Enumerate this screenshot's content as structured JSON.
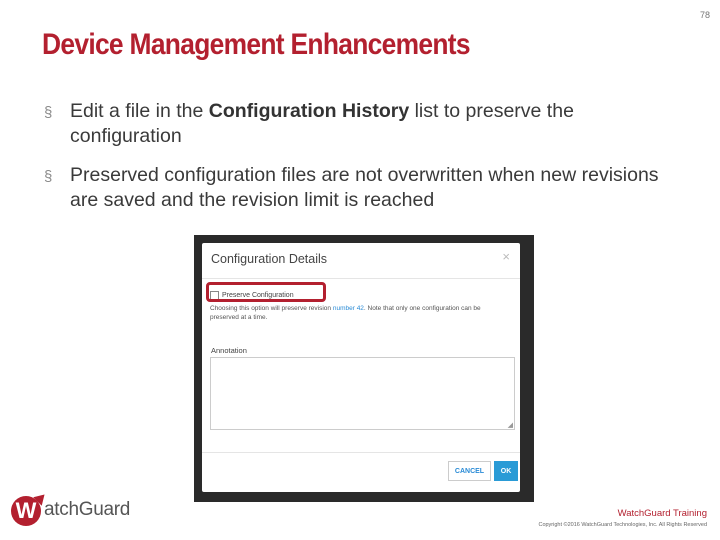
{
  "page_number": "78",
  "title": "Device Management Enhancements",
  "bullets": [
    {
      "before": "Edit a file in the ",
      "bold": "Configuration History",
      "after": " list to preserve the configuration"
    },
    {
      "before": "Preserved configuration files are not overwritten when new revisions are saved and the revision limit is reached",
      "bold": "",
      "after": ""
    }
  ],
  "bullet_mark": "§",
  "dialog": {
    "title": "Configuration Details",
    "close": "×",
    "preserve_label": "Preserve Configuration",
    "note_before": "Choosing this option will preserve revision ",
    "note_revision": "number 42",
    "note_after": ". Note that only one configuration can be preserved at a time.",
    "annotation_label": "Annotation",
    "annotation_value": "",
    "cancel_label": "CANCEL",
    "ok_label": "OK"
  },
  "colors": {
    "accent": "#b3202f",
    "link": "#2a8bd6",
    "ok_button": "#2a9bd6"
  },
  "footer": {
    "logo_text": "atchGuard",
    "logo_letter": "W",
    "training": "WatchGuard Training",
    "copyright": "Copyright ©2016 WatchGuard Technologies, Inc. All Rights Reserved"
  }
}
